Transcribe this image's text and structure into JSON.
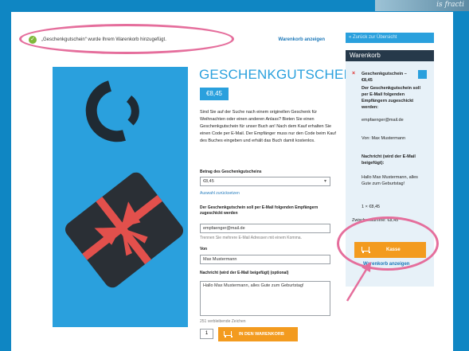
{
  "corner_image": {
    "text": "is fracti"
  },
  "notice": {
    "message": "„Geschenkgutschein“ wurde Ihrem Warenkorb hinzugefügt.",
    "view_cart_label": "Warenkorb anzeigen"
  },
  "product": {
    "title": "GESCHENKGUTSCHEIN",
    "price": "€8,45",
    "description": "Sind Sie auf der Suche nach einem originellen Geschenk für Weihnachten oder einen anderen Anlass? Bieten Sie einen Geschenkgutschein für unser Buch an! Nach dem Kauf erhalten Sie einen Code per E-Mail. Der Empfänger muss nur den Code beim Kauf des Buches eingeben und erhält das Buch damit kostenlos.",
    "amount_label": "Betrag des Geschenkgutscheins",
    "amount_value": "€8,45",
    "reset_selection": "Auswahl zurücksetzen",
    "recipient_label": "Der Geschenkgutschein soll per E-Mail folgenden Empfängern zugeschickt werden",
    "recipient_value": "empfaenger@mail.de",
    "recipient_hint": "Trennen Sie mehrere E-Mail Adressen mit einem Komma.",
    "from_label": "Von",
    "from_value": "Max Mustermann",
    "message_label": "Nachricht (wird der E-Mail beigefügt) (optional)",
    "message_value": "Hallo Max Mustermann, alles Gute zum Geburtstag!",
    "chars_remaining": "251 verbleibende Zeichen",
    "quantity": "1",
    "add_to_cart_label": "IN DEN WARENKORB"
  },
  "sidebar": {
    "back_label": "« Zurück zur Übersicht",
    "cart_title": "Warenkorb",
    "item": {
      "remove": "×",
      "name": "Geschenkgutschein – €8,45",
      "recipient_label": "Der Geschenkgutschein soll per E-Mail folgenden Empfängern zugeschickt werden:",
      "recipient_value": "empfaenger@mail.de",
      "from_text": "Von: Max Mustermann",
      "message_label": "Nachricht (wird der E-Mail beigefügt):",
      "message_value": "Hallo Max Mustermann, alles Gute zum Geburtstag!",
      "line_total": "1 × €8,45"
    },
    "subtotal": "Zwischensumme: €8,45",
    "checkout_label": "Kasse",
    "view_cart_label": "Warenkorb anzeigen"
  },
  "colors": {
    "accent": "#2aa0dd",
    "button": "#f39b1f",
    "annotation": "#e56e9c",
    "cart_header": "#26394a"
  },
  "icons": [
    "check-icon",
    "cart-icon",
    "remove-icon",
    "arrow-annotation"
  ]
}
